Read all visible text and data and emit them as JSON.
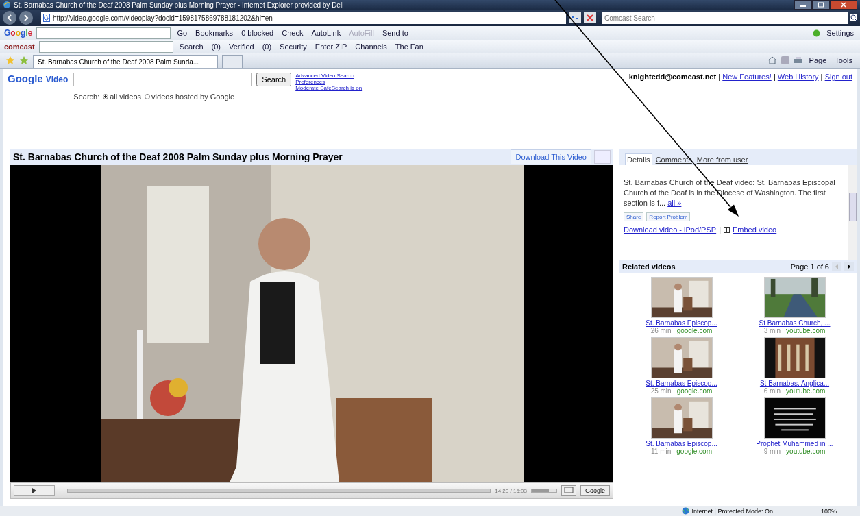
{
  "window": {
    "title": "St. Barnabas Church of the Deaf 2008 Palm Sunday plus Morning Prayer - Internet Explorer provided by Dell"
  },
  "address_bar": {
    "url": "http://video.google.com/videoplay?docid=1598175869788181202&hl=en",
    "search_placeholder": "Comcast Search"
  },
  "google_toolbar": {
    "logo": "Google",
    "items": [
      {
        "label": "Go",
        "disabled": false
      },
      {
        "label": "Bookmarks",
        "disabled": false
      },
      {
        "label": "0 blocked",
        "disabled": false
      },
      {
        "label": "Check",
        "disabled": false
      },
      {
        "label": "AutoLink",
        "disabled": false
      },
      {
        "label": "AutoFill",
        "disabled": true
      },
      {
        "label": "Send to",
        "disabled": false
      }
    ],
    "settings": "Settings"
  },
  "comcast_toolbar": {
    "logo": "comcast",
    "items": [
      "Search",
      "(0)",
      "Verified",
      "(0)",
      "Security",
      "Enter ZIP",
      "Channels",
      "The Fan"
    ]
  },
  "tab_bar": {
    "tab": "St. Barnabas Church of the Deaf 2008 Palm Sunda...",
    "commands": [
      "Page",
      "Tools"
    ]
  },
  "header": {
    "logo": "Google",
    "logo_suffix": "Video",
    "search_button": "Search",
    "search_label": "Search:",
    "radios": [
      {
        "label": "all videos",
        "selected": true
      },
      {
        "label": "videos hosted by Google",
        "selected": false
      }
    ],
    "links": [
      "Advanced Video Search",
      "Preferences",
      "Moderate SafeSearch is on"
    ],
    "user": "knightedd@comcast.net",
    "user_links": [
      "New Features!",
      "Web History",
      "Sign out"
    ],
    "separator": "|"
  },
  "video": {
    "volume": {
      "level": 0.7
    },
    "title": "St. Barnabas Church of the Deaf 2008 Palm Sunday plus Morning Prayer",
    "download_button": "Download This Video",
    "time": "14:20 / 15:03",
    "menu_button": "Google"
  },
  "details": {
    "tabs": [
      {
        "label": "Details",
        "selected": true
      },
      {
        "label": "Comments",
        "selected": false
      },
      {
        "label": "More from user",
        "selected": false
      }
    ],
    "description": "St. Barnabas Church of the Deaf video: St. Barnabas Episcopal Church of the Deaf is in the Diocese of Washington. The first section is f...",
    "more_link": "all »",
    "buttons": [
      "Share",
      "Report Problem"
    ],
    "download_link": "Download video - iPod/PSP",
    "separator": "|",
    "embed_link": "Embed video"
  },
  "related": {
    "title": "Related videos",
    "page": "Page 1 of 6",
    "items": [
      {
        "title": "St. Barnabas Episcop...",
        "duration": "26 min",
        "source": "google.com"
      },
      {
        "title": "St Barnabas Church, ...",
        "duration": "3 min",
        "source": "youtube.com"
      },
      {
        "title": "St. Barnabas Episcop...",
        "duration": "25 min",
        "source": "google.com"
      },
      {
        "title": "St Barnabas, Anglica...",
        "duration": "6 min",
        "source": "youtube.com"
      },
      {
        "title": "St. Barnabas Episcop...",
        "duration": "11 min",
        "source": "google.com"
      },
      {
        "title": "Prophet Muhammed in ...",
        "duration": "9 min",
        "source": "youtube.com"
      }
    ]
  },
  "status_bar": {
    "zone": "Internet | Protected Mode: On",
    "zoom": "100%"
  }
}
